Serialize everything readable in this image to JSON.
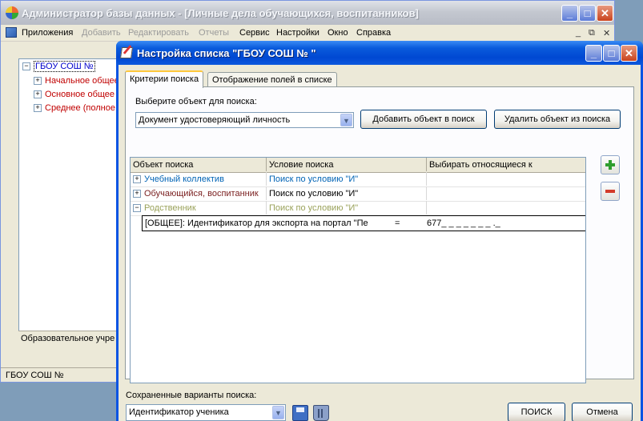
{
  "main_window": {
    "title": "Администратор базы данных - [Личные дела обучающихся, воспитанников]",
    "menu": [
      "Приложения",
      "Добавить",
      "Редактировать",
      "Отчеты",
      "Сервис",
      "Настройки",
      "Окно",
      "Справка"
    ],
    "menu_disabled": [
      false,
      true,
      true,
      true,
      false,
      false,
      false,
      false
    ],
    "tree": {
      "root": "ГБОУ СОШ №",
      "children": [
        "Начальное общее",
        "Основное общее",
        "Среднее (полное"
      ]
    },
    "panel_status": "Образовательное учре",
    "status_bar": "ГБОУ СОШ №"
  },
  "dialog": {
    "title": "Настройка списка  \"ГБОУ СОШ №        \"",
    "tabs": [
      "Критерии поиска",
      "Отображение полей в списке"
    ],
    "select_object_label": "Выберите объект для поиска:",
    "select_object_value": "Документ удостоверяющий личность",
    "add_object_button": "Добавить объект в поиск",
    "remove_object_button": "Удалить объект из поиска",
    "grid": {
      "headers": [
        "Объект поиска",
        "Условие поиска",
        "Выбирать относящиеся к"
      ],
      "rows": [
        {
          "object": "Учебный коллектив",
          "condition": "Поиск по условию \"И\"",
          "relates": ""
        },
        {
          "object": "Обучающийся, воспитанник",
          "condition": "Поиск по условию \"И\"",
          "relates": ""
        },
        {
          "object": "Родственник",
          "condition": "Поиск по условию \"И\"",
          "relates": ""
        }
      ],
      "subrow": {
        "field": "[ОБЩЕЕ]: Идентификатор для экспорта на портал \"Пе",
        "operator": "=",
        "value": "677_ _ _ _ _ _ _ ._"
      }
    },
    "saved_label": "Сохраненные варианты поиска:",
    "saved_value": "Идентификатор ученика",
    "search_button": "ПОИСК",
    "cancel_button": "Отмена"
  },
  "colors": {
    "titlebar_active": "#0a54e3",
    "tree_red": "#c00000",
    "link_blue": "#0063b5"
  }
}
